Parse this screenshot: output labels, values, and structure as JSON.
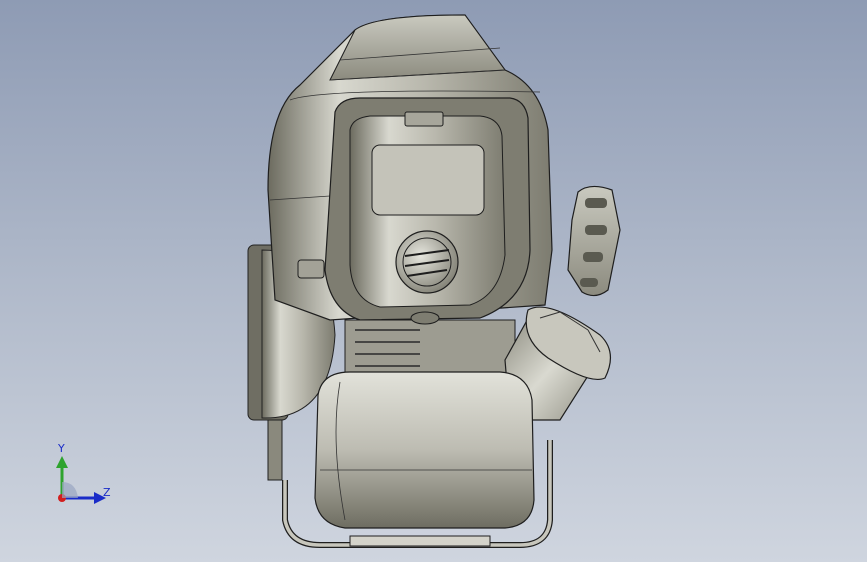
{
  "viewport": {
    "background_top": "#8e9bb4",
    "background_bottom": "#cfd5df",
    "model": "engine-assembly",
    "shading": "shaded-with-edges"
  },
  "triad": {
    "labels": {
      "y": "Y",
      "z": "Z"
    },
    "colors": {
      "y": "#2ea32e",
      "z": "#1a2cc8",
      "x": "#d21e1e"
    }
  }
}
